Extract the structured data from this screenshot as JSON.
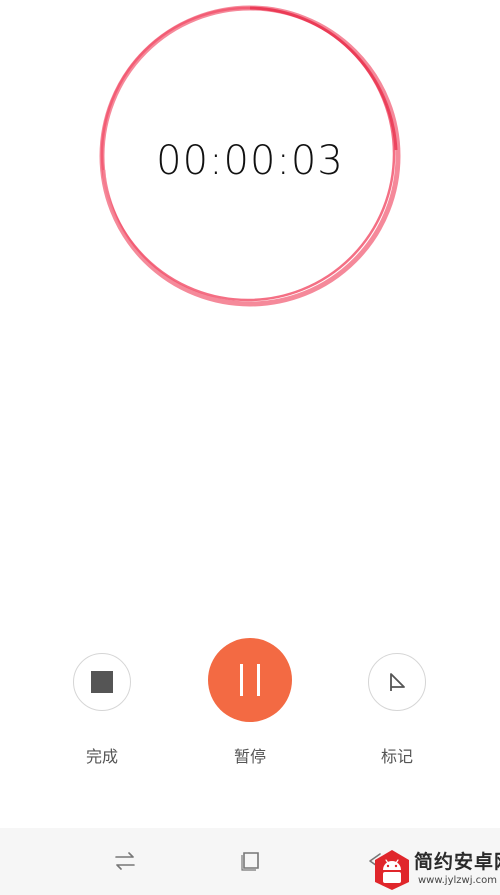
{
  "timer": {
    "elapsed": "00:00:03"
  },
  "controls": {
    "finish_label": "完成",
    "pause_label": "暂停",
    "mark_label": "标记"
  },
  "icons": {
    "finish": "stop-square-icon",
    "pause": "pause-icon",
    "mark": "flag-icon",
    "nav_switch": "switch-arrows-icon",
    "nav_home": "square-home-icon",
    "nav_back": "back-arrow-icon"
  },
  "colors": {
    "ring": "#f2566f",
    "pause_button": "#f36a43",
    "nav_bar": "#f6f6f6",
    "watermark_accent": "#e0262b"
  },
  "watermark": {
    "title": "简约安卓网",
    "url": "www.jylzwj.com"
  }
}
